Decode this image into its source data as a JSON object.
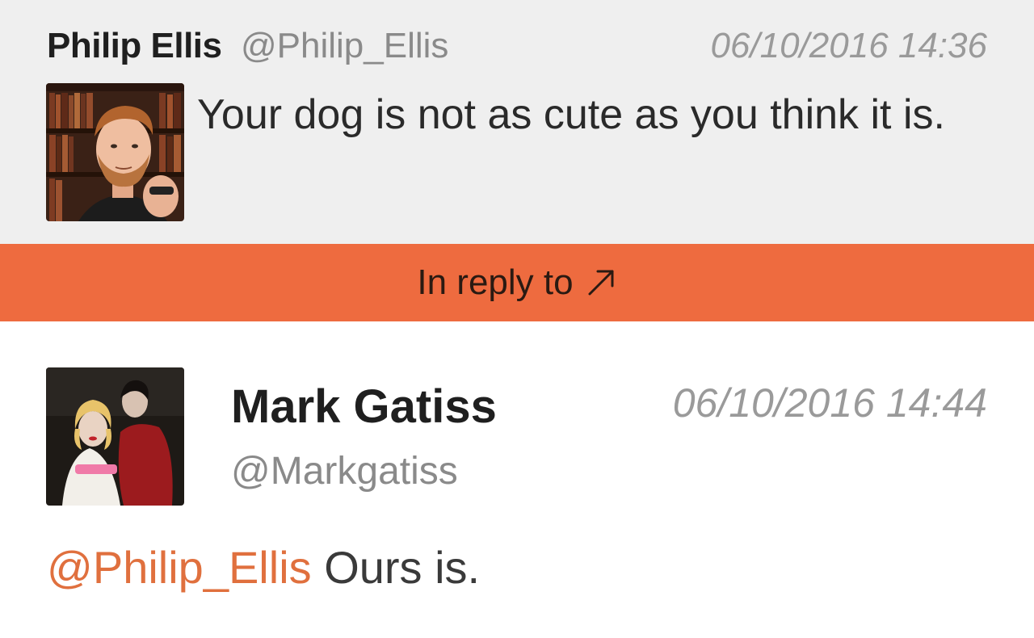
{
  "original_tweet": {
    "author_name": "Philip Ellis",
    "author_handle": "@Philip_Ellis",
    "timestamp": "06/10/2016 14:36",
    "text": "Your dog is not as cute as you think it is."
  },
  "reply_bar": {
    "label": "In reply to",
    "icon": "arrow-up-right-icon",
    "background_color": "#ee6b3f"
  },
  "reply_tweet": {
    "author_name": "Mark Gatiss",
    "author_handle": "@Markgatiss",
    "timestamp": "06/10/2016 14:44",
    "mention": "@Philip_Ellis",
    "text": " Ours is."
  },
  "colors": {
    "mention": "#e0703e",
    "original_background": "#efefef"
  }
}
